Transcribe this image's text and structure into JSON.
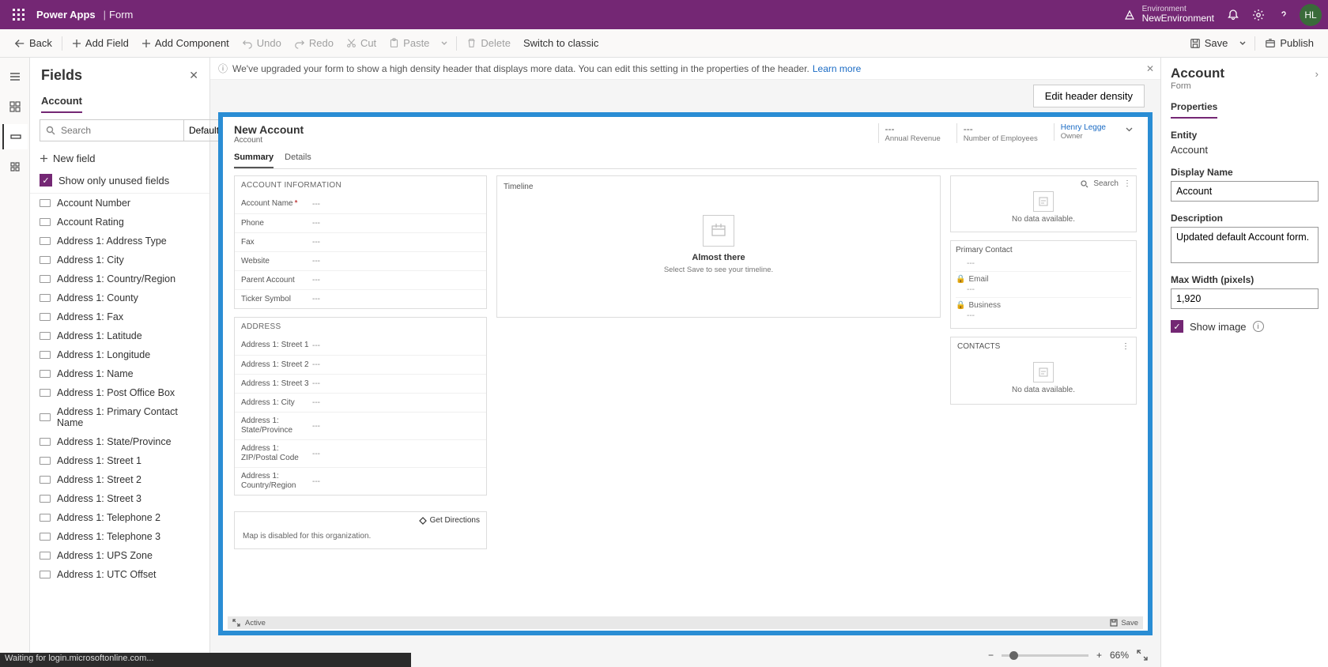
{
  "header": {
    "product": "Power Apps",
    "separator": "|",
    "page": "Form",
    "environment_label": "Environment",
    "environment_name": "NewEnvironment",
    "avatar_initials": "HL"
  },
  "commands": {
    "back": "Back",
    "add_field": "Add Field",
    "add_component": "Add Component",
    "undo": "Undo",
    "redo": "Redo",
    "cut": "Cut",
    "paste": "Paste",
    "delete": "Delete",
    "switch_classic": "Switch to classic",
    "save": "Save",
    "publish": "Publish"
  },
  "fields_panel": {
    "title": "Fields",
    "tab": "Account",
    "search_placeholder": "Search",
    "filter_default": "Default",
    "new_field": "New field",
    "show_unused": "Show only unused fields",
    "items": [
      "Account Number",
      "Account Rating",
      "Address 1: Address Type",
      "Address 1: City",
      "Address 1: Country/Region",
      "Address 1: County",
      "Address 1: Fax",
      "Address 1: Latitude",
      "Address 1: Longitude",
      "Address 1: Name",
      "Address 1: Post Office Box",
      "Address 1: Primary Contact Name",
      "Address 1: State/Province",
      "Address 1: Street 1",
      "Address 1: Street 2",
      "Address 1: Street 3",
      "Address 1: Telephone 2",
      "Address 1: Telephone 3",
      "Address 1: UPS Zone",
      "Address 1: UTC Offset"
    ]
  },
  "info_bar": {
    "message": "We've upgraded your form to show a high density header that displays more data. You can edit this setting in the properties of the header.",
    "learn_more": "Learn more",
    "edit_density": "Edit header density"
  },
  "form": {
    "title": "New Account",
    "entity": "Account",
    "header_cols": [
      {
        "value": "---",
        "label": "Annual Revenue"
      },
      {
        "value": "---",
        "label": "Number of Employees"
      }
    ],
    "owner_name": "Henry Legge",
    "owner_label": "Owner",
    "tabs": [
      "Summary",
      "Details"
    ],
    "section_account_info": "ACCOUNT INFORMATION",
    "account_fields": [
      {
        "label": "Account Name",
        "required": true,
        "value": "---"
      },
      {
        "label": "Phone",
        "value": "---"
      },
      {
        "label": "Fax",
        "value": "---"
      },
      {
        "label": "Website",
        "value": "---"
      },
      {
        "label": "Parent Account",
        "value": "---"
      },
      {
        "label": "Ticker Symbol",
        "value": "---"
      }
    ],
    "section_address": "ADDRESS",
    "address_fields": [
      {
        "label": "Address 1: Street 1",
        "value": "---"
      },
      {
        "label": "Address 1: Street 2",
        "value": "---"
      },
      {
        "label": "Address 1: Street 3",
        "value": "---"
      },
      {
        "label": "Address 1: City",
        "value": "---"
      },
      {
        "label": "Address 1: State/Province",
        "value": "---"
      },
      {
        "label": "Address 1: ZIP/Postal Code",
        "value": "---"
      },
      {
        "label": "Address 1: Country/Region",
        "value": "---"
      }
    ],
    "timeline": {
      "title": "Timeline",
      "almost": "Almost there",
      "hint": "Select Save to see your timeline."
    },
    "right_search": {
      "search": "Search",
      "no_data": "No data available."
    },
    "primary_contact": {
      "title": "Primary Contact",
      "blank": "---",
      "email": "Email",
      "email_val": "---",
      "business": "Business",
      "business_val": "---"
    },
    "contacts": {
      "title": "CONTACTS",
      "no_data": "No data available."
    },
    "directions": {
      "get": "Get Directions",
      "msg": "Map is disabled for this organization."
    },
    "footer": {
      "status": "Active",
      "save": "Save"
    }
  },
  "zoom": {
    "minus": "−",
    "plus": "+",
    "pct": "66%"
  },
  "props": {
    "title": "Account",
    "sub": "Form",
    "tab": "Properties",
    "entity_label": "Entity",
    "entity_value": "Account",
    "display_name_label": "Display Name",
    "display_name_value": "Account",
    "description_label": "Description",
    "description_value": "Updated default Account form.",
    "max_width_label": "Max Width (pixels)",
    "max_width_value": "1,920",
    "show_image": "Show image"
  },
  "status_bar": "Waiting for login.microsoftonline.com..."
}
